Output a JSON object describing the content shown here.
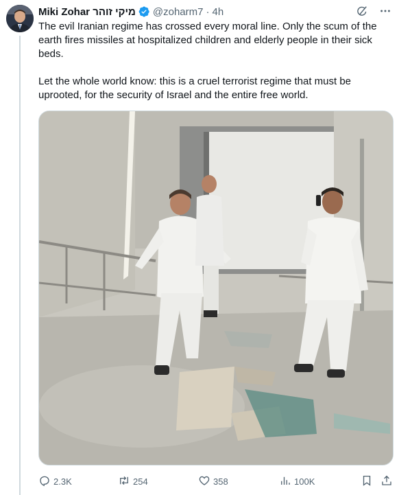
{
  "tweet": {
    "author_name": "Miki Zohar מיקי זוהר",
    "handle": "@zoharm7",
    "separator": "·",
    "time": "4h",
    "paragraphs": [
      "The evil Iranian regime has crossed every moral line. Only the scum of the earth fires missiles at hospitalized children and elderly people in their sick beds.",
      "Let the whole world know: this is a cruel terrorist regime that must be uprooted, for the security of Israel and the entire free world."
    ]
  },
  "actions": {
    "replies": "2.3K",
    "retweets": "254",
    "likes": "358",
    "views": "100K"
  },
  "icons": {
    "header": [
      "verified-icon",
      "grok-icon",
      "more-icon"
    ],
    "actions": [
      "reply-icon",
      "retweet-icon",
      "like-icon",
      "views-icon",
      "bookmark-icon",
      "share-icon"
    ]
  },
  "colors": {
    "text": "#0f1419",
    "secondary": "#536471",
    "verified_blue": "#1d9bf0",
    "border": "#cfd9de"
  }
}
